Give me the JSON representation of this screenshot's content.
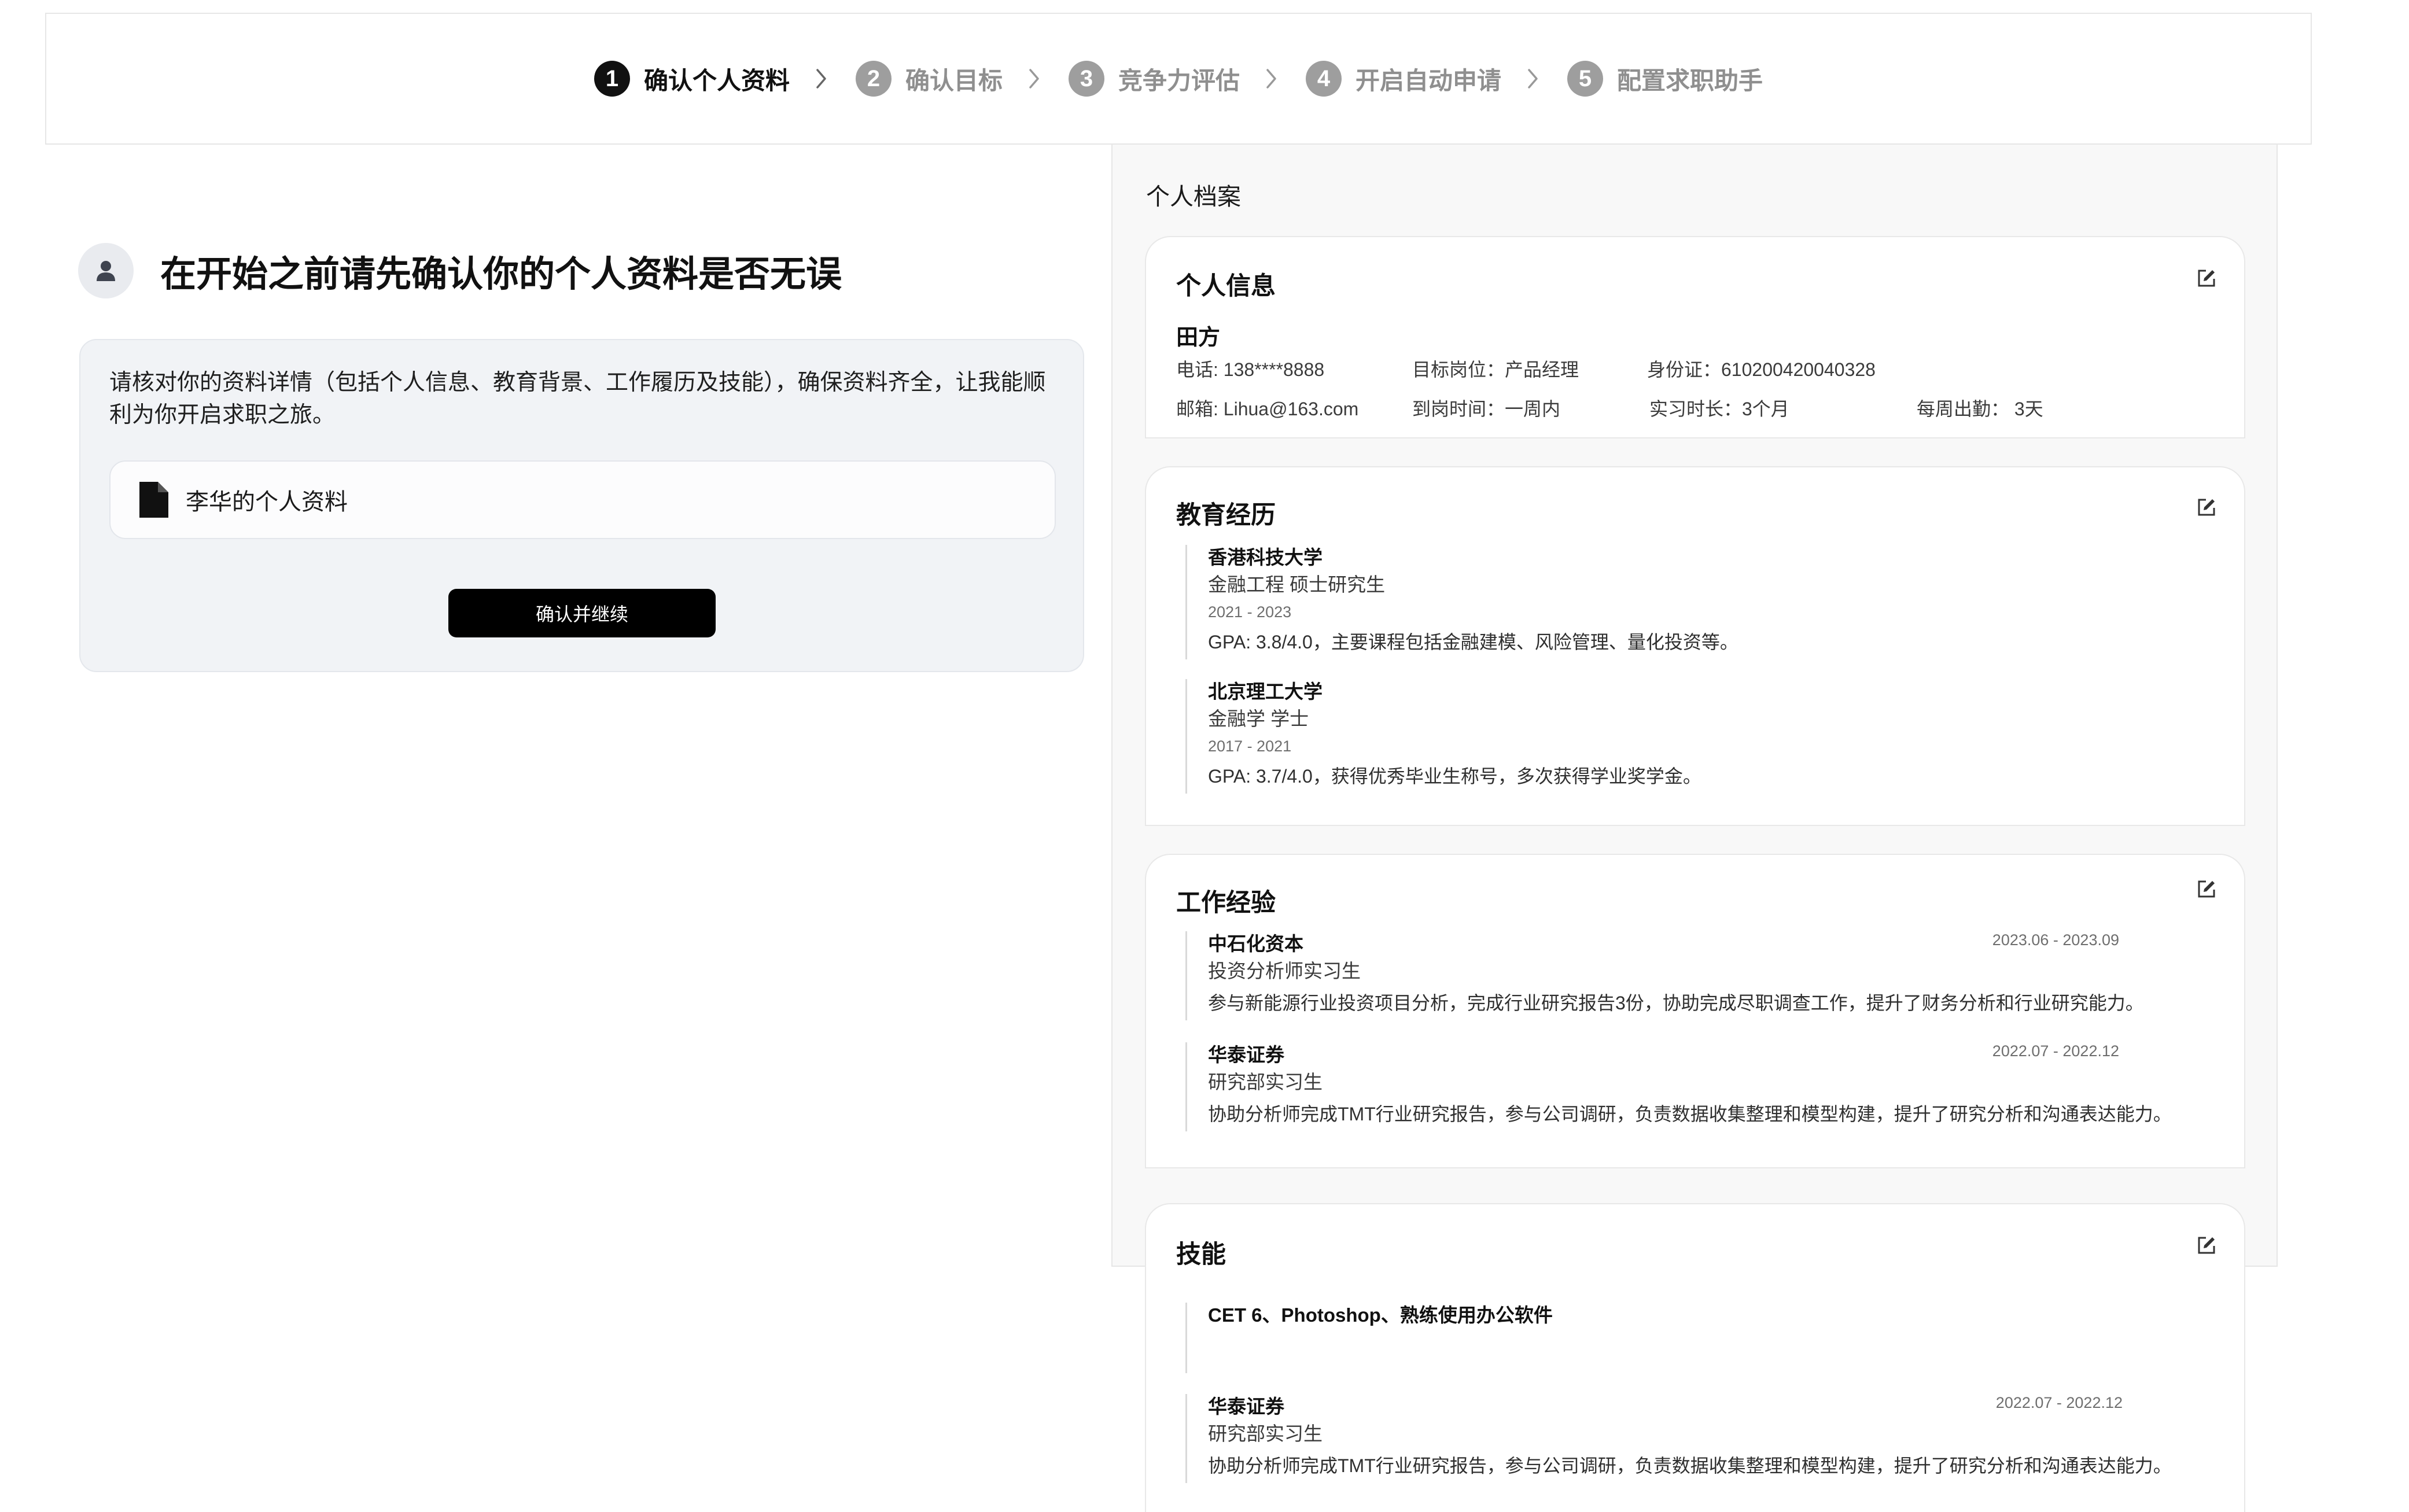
{
  "stepper": {
    "steps": [
      {
        "num": "1",
        "label": "确认个人资料"
      },
      {
        "num": "2",
        "label": "确认目标"
      },
      {
        "num": "3",
        "label": "竞争力评估"
      },
      {
        "num": "4",
        "label": "开启自动申请"
      },
      {
        "num": "5",
        "label": "配置求职助手"
      }
    ],
    "active_step": 1
  },
  "left": {
    "title": "在开始之前请先确认你的个人资料是否无误",
    "description": "请核对你的资料详情（包括个人信息、教育背景、工作履历及技能），确保资料齐全，让我能顺利为你开启求职之旅。",
    "file_name": "李华的个人资料",
    "confirm_label": "确认并继续"
  },
  "profile": {
    "title": "个人档案",
    "personal": {
      "title": "个人信息",
      "name": "田方",
      "phone": "电话: 138****8888",
      "target_role": "目标岗位：产品经理",
      "id_card": "身份证：610200420040328",
      "email": "邮箱: Lihua@163.com",
      "onboard": "到岗时间：一周内",
      "intern_length": "实习时长：3个月",
      "weekly_days": "每周出勤： 3天"
    },
    "education": {
      "title": "教育经历",
      "items": [
        {
          "school": "香港科技大学",
          "degree": "金融工程 硕士研究生",
          "years": "2021 - 2023",
          "desc": "GPA: 3.8/4.0，主要课程包括金融建模、风险管理、量化投资等。"
        },
        {
          "school": "北京理工大学",
          "degree": "金融学 学士",
          "years": "2017 - 2021",
          "desc": "GPA: 3.7/4.0，获得优秀毕业生称号，多次获得学业奖学金。"
        }
      ]
    },
    "work": {
      "title": "工作经验",
      "items": [
        {
          "company": "中石化资本",
          "role": "投资分析师实习生",
          "dates": "2023.06 - 2023.09",
          "desc": "参与新能源行业投资项目分析，完成行业研究报告3份，协助完成尽职调查工作，提升了财务分析和行业研究能力。"
        },
        {
          "company": "华泰证券",
          "role": "研究部实习生",
          "dates": "2022.07 - 2022.12",
          "desc": "协助分析师完成TMT行业研究报告，参与公司调研，负责数据收集整理和模型构建，提升了研究分析和沟通表达能力。"
        }
      ]
    },
    "skills": {
      "title": "技能",
      "summary": "CET 6、Photoshop、熟练使用办公软件",
      "items": [
        {
          "company": "华泰证券",
          "role": "研究部实习生",
          "dates": "2022.07 - 2022.12",
          "desc": "协助分析师完成TMT行业研究报告，参与公司调研，负责数据收集整理和模型构建，提升了研究分析和沟通表达能力。"
        }
      ]
    }
  },
  "colors": {
    "accent": "#000000",
    "panel": "#f1f3f6",
    "profile_bg": "#f8f8f8",
    "muted": "#9e9e9e"
  }
}
